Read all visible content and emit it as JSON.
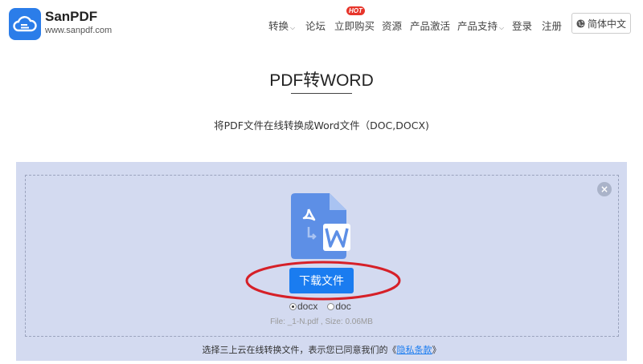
{
  "header": {
    "brand": "SanPDF",
    "url": "www.sanpdf.com",
    "nav": [
      {
        "label": "转换",
        "dropdown": true
      },
      {
        "label": "论坛",
        "dropdown": false
      },
      {
        "label": "立即购买",
        "dropdown": false,
        "badge": "HOT"
      },
      {
        "label": "资源",
        "dropdown": false
      },
      {
        "label": "产品激活",
        "dropdown": false
      },
      {
        "label": "产品支持",
        "dropdown": true
      },
      {
        "label": "登录",
        "dropdown": false
      },
      {
        "label": "注册",
        "dropdown": false
      }
    ],
    "language": "简体中文"
  },
  "main": {
    "title": "PDF转WORD",
    "subtitle": "将PDF文件在线转换成Word文件（DOC,DOCX)"
  },
  "converter": {
    "download_label": "下载文件",
    "formats": [
      {
        "label": "docx",
        "selected": true
      },
      {
        "label": "doc",
        "selected": false
      }
    ],
    "file_info": "File: _1-N.pdf , Size: 0.06MB",
    "agreement_prefix": "选择三上云在线转换文件，表示您已同意我们的《",
    "agreement_link": "隐私条款",
    "agreement_suffix": "》",
    "close_symbol": "×",
    "icons": {
      "logo": "cloud-logo-icon",
      "file": "pdf-to-word-file-icon",
      "close": "close-icon",
      "globe": "globe-icon"
    }
  },
  "colors": {
    "brand_blue": "#2b7de9",
    "button_blue": "#1a7cf0",
    "panel_bg": "#d3daf0",
    "hot_red": "#e7352b",
    "highlight_red": "#d62028"
  }
}
